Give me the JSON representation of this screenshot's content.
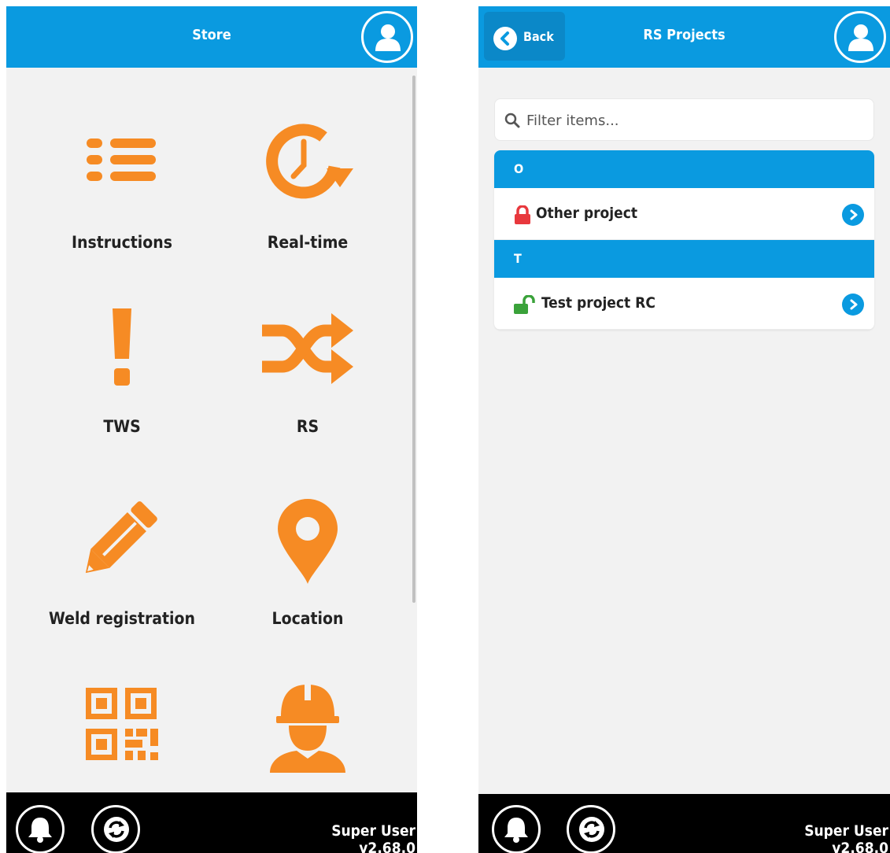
{
  "colors": {
    "brand_blue": "#0a9ae0",
    "accent_orange": "#f68b24",
    "lock_locked": "#e8383d",
    "lock_unlocked": "#3aa23a"
  },
  "store": {
    "title": "Store",
    "items": [
      {
        "label": "Instructions",
        "icon": "list-icon"
      },
      {
        "label": "Real-time",
        "icon": "clock-refresh-icon"
      },
      {
        "label": "TWS",
        "icon": "exclamation-icon"
      },
      {
        "label": "RS",
        "icon": "shuffle-icon"
      },
      {
        "label": "Weld registration",
        "icon": "pencil-icon"
      },
      {
        "label": "Location",
        "icon": "map-marker-icon"
      },
      {
        "label": "",
        "icon": "qr-code-icon"
      },
      {
        "label": "",
        "icon": "worker-helmet-icon"
      }
    ]
  },
  "projects": {
    "back_label": "Back",
    "title": "RS Projects",
    "search_placeholder": "Filter items...",
    "groups": [
      {
        "letter": "O",
        "items": [
          {
            "label": "Other project",
            "locked": true
          }
        ]
      },
      {
        "letter": "T",
        "items": [
          {
            "label": "Test project RC",
            "locked": false
          }
        ]
      }
    ]
  },
  "footer": {
    "user_name": "Super User",
    "version": "v2.68.0"
  }
}
